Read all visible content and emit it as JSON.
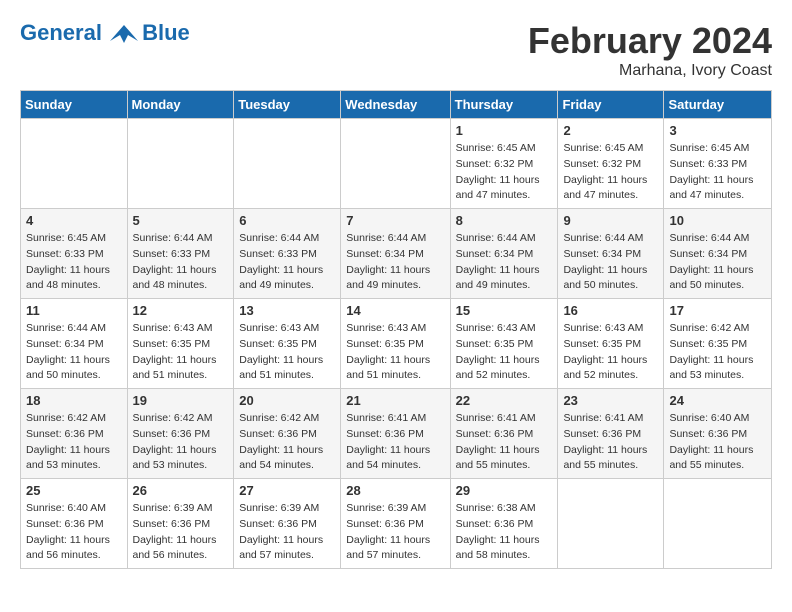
{
  "header": {
    "logo_line1": "General",
    "logo_line2": "Blue",
    "month": "February 2024",
    "location": "Marhana, Ivory Coast"
  },
  "days_of_week": [
    "Sunday",
    "Monday",
    "Tuesday",
    "Wednesday",
    "Thursday",
    "Friday",
    "Saturday"
  ],
  "weeks": [
    [
      {
        "num": "",
        "info": ""
      },
      {
        "num": "",
        "info": ""
      },
      {
        "num": "",
        "info": ""
      },
      {
        "num": "",
        "info": ""
      },
      {
        "num": "1",
        "info": "Sunrise: 6:45 AM\nSunset: 6:32 PM\nDaylight: 11 hours\nand 47 minutes."
      },
      {
        "num": "2",
        "info": "Sunrise: 6:45 AM\nSunset: 6:32 PM\nDaylight: 11 hours\nand 47 minutes."
      },
      {
        "num": "3",
        "info": "Sunrise: 6:45 AM\nSunset: 6:33 PM\nDaylight: 11 hours\nand 47 minutes."
      }
    ],
    [
      {
        "num": "4",
        "info": "Sunrise: 6:45 AM\nSunset: 6:33 PM\nDaylight: 11 hours\nand 48 minutes."
      },
      {
        "num": "5",
        "info": "Sunrise: 6:44 AM\nSunset: 6:33 PM\nDaylight: 11 hours\nand 48 minutes."
      },
      {
        "num": "6",
        "info": "Sunrise: 6:44 AM\nSunset: 6:33 PM\nDaylight: 11 hours\nand 49 minutes."
      },
      {
        "num": "7",
        "info": "Sunrise: 6:44 AM\nSunset: 6:34 PM\nDaylight: 11 hours\nand 49 minutes."
      },
      {
        "num": "8",
        "info": "Sunrise: 6:44 AM\nSunset: 6:34 PM\nDaylight: 11 hours\nand 49 minutes."
      },
      {
        "num": "9",
        "info": "Sunrise: 6:44 AM\nSunset: 6:34 PM\nDaylight: 11 hours\nand 50 minutes."
      },
      {
        "num": "10",
        "info": "Sunrise: 6:44 AM\nSunset: 6:34 PM\nDaylight: 11 hours\nand 50 minutes."
      }
    ],
    [
      {
        "num": "11",
        "info": "Sunrise: 6:44 AM\nSunset: 6:34 PM\nDaylight: 11 hours\nand 50 minutes."
      },
      {
        "num": "12",
        "info": "Sunrise: 6:43 AM\nSunset: 6:35 PM\nDaylight: 11 hours\nand 51 minutes."
      },
      {
        "num": "13",
        "info": "Sunrise: 6:43 AM\nSunset: 6:35 PM\nDaylight: 11 hours\nand 51 minutes."
      },
      {
        "num": "14",
        "info": "Sunrise: 6:43 AM\nSunset: 6:35 PM\nDaylight: 11 hours\nand 51 minutes."
      },
      {
        "num": "15",
        "info": "Sunrise: 6:43 AM\nSunset: 6:35 PM\nDaylight: 11 hours\nand 52 minutes."
      },
      {
        "num": "16",
        "info": "Sunrise: 6:43 AM\nSunset: 6:35 PM\nDaylight: 11 hours\nand 52 minutes."
      },
      {
        "num": "17",
        "info": "Sunrise: 6:42 AM\nSunset: 6:35 PM\nDaylight: 11 hours\nand 53 minutes."
      }
    ],
    [
      {
        "num": "18",
        "info": "Sunrise: 6:42 AM\nSunset: 6:36 PM\nDaylight: 11 hours\nand 53 minutes."
      },
      {
        "num": "19",
        "info": "Sunrise: 6:42 AM\nSunset: 6:36 PM\nDaylight: 11 hours\nand 53 minutes."
      },
      {
        "num": "20",
        "info": "Sunrise: 6:42 AM\nSunset: 6:36 PM\nDaylight: 11 hours\nand 54 minutes."
      },
      {
        "num": "21",
        "info": "Sunrise: 6:41 AM\nSunset: 6:36 PM\nDaylight: 11 hours\nand 54 minutes."
      },
      {
        "num": "22",
        "info": "Sunrise: 6:41 AM\nSunset: 6:36 PM\nDaylight: 11 hours\nand 55 minutes."
      },
      {
        "num": "23",
        "info": "Sunrise: 6:41 AM\nSunset: 6:36 PM\nDaylight: 11 hours\nand 55 minutes."
      },
      {
        "num": "24",
        "info": "Sunrise: 6:40 AM\nSunset: 6:36 PM\nDaylight: 11 hours\nand 55 minutes."
      }
    ],
    [
      {
        "num": "25",
        "info": "Sunrise: 6:40 AM\nSunset: 6:36 PM\nDaylight: 11 hours\nand 56 minutes."
      },
      {
        "num": "26",
        "info": "Sunrise: 6:39 AM\nSunset: 6:36 PM\nDaylight: 11 hours\nand 56 minutes."
      },
      {
        "num": "27",
        "info": "Sunrise: 6:39 AM\nSunset: 6:36 PM\nDaylight: 11 hours\nand 57 minutes."
      },
      {
        "num": "28",
        "info": "Sunrise: 6:39 AM\nSunset: 6:36 PM\nDaylight: 11 hours\nand 57 minutes."
      },
      {
        "num": "29",
        "info": "Sunrise: 6:38 AM\nSunset: 6:36 PM\nDaylight: 11 hours\nand 58 minutes."
      },
      {
        "num": "",
        "info": ""
      },
      {
        "num": "",
        "info": ""
      }
    ]
  ]
}
